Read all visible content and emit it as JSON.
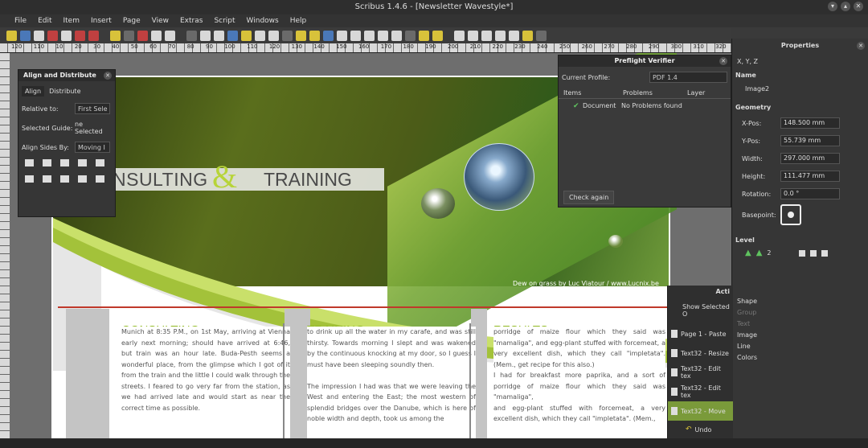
{
  "window": {
    "title": "Scribus 1.4.6 - [Newsletter Wavestyle*]",
    "controls": [
      "▾",
      "▴",
      "✕"
    ]
  },
  "menu": [
    "File",
    "Edit",
    "Item",
    "Insert",
    "Page",
    "View",
    "Extras",
    "Script",
    "Windows",
    "Help"
  ],
  "ruler_labels": [
    "120",
    "110",
    "10",
    "20",
    "30",
    "40",
    "50",
    "60",
    "70",
    "80",
    "90",
    "100",
    "110",
    "120",
    "130",
    "140",
    "150",
    "160",
    "170",
    "180",
    "190",
    "200",
    "210",
    "220",
    "230",
    "240",
    "250",
    "260",
    "270",
    "280",
    "290",
    "300",
    "310",
    "320"
  ],
  "document": {
    "header_consulting": "NSULTING",
    "header_amp": "&",
    "header_training": "TRAINING",
    "photo_caption": "Dew on grass by Luc Viatour / www.Lucnix.be",
    "columns": [
      {
        "heading": "CONSULTING",
        "text": "Munich at 8:35 P.M., on 1st May, arriving at Vienna early next morning; should have arrived at 6:46, but train was an hour late. Buda-Pesth seems a wonderful place, from the glimpse which I got of it from the train and the little I could walk through the streets. I feared to go very far from the station, as we had arrived late and would start as near the correct time as possible."
      },
      {
        "heading": "TRAINING",
        "text": "to drink up all the water in my carafe, and was still thirsty. Towards morning I slept and was wakened by the continuous knocking at my door, so I guess I must have been sleeping soundly then.\n\nThe impression I had was that we were leaving the West and entering the East; the most western of splendid bridges over the Danube, which is here of noble width and depth, took us among the"
      },
      {
        "heading": "RESULTS",
        "text": "porridge of maize flour which they said was \"mamaliga\", and egg-plant stuffed with forcemeat, a very excellent dish, which they call \"impletata\". (Mem., get recipe for this also.)\nI had for breakfast more paprika, and a sort of porridge of maize flour which they said was \"mamaliga\",\nand egg-plant stuffed with forcemeat, a very excellent dish, which they call \"impletata\". (Mem.,"
      }
    ]
  },
  "align_panel": {
    "title": "Align and Distribute",
    "tabs": [
      "Align",
      "Distribute"
    ],
    "relative_label": "Relative to:",
    "relative_value": "First Sele",
    "guide_label": "Selected Guide:",
    "guide_value": "ne Selected",
    "sides_label": "Align Sides By:",
    "sides_value": "Moving I"
  },
  "preflight": {
    "title": "Preflight Verifier",
    "profile_label": "Current Profile:",
    "profile_value": "PDF 1.4",
    "columns": [
      "Items",
      "Problems",
      "Layer"
    ],
    "row_item": "Document",
    "row_problem": "No Problems found",
    "check_button": "Check again"
  },
  "properties": {
    "title": "Properties",
    "tab_xyz": "X, Y, Z",
    "name_label": "Name",
    "name_value": "Image2",
    "geometry_label": "Geometry",
    "fields": [
      {
        "label": "X-Pos:",
        "value": "148.500 mm"
      },
      {
        "label": "Y-Pos:",
        "value": "55.739 mm"
      },
      {
        "label": "Width:",
        "value": "297.000 mm"
      },
      {
        "label": "Height:",
        "value": "111.477 mm"
      },
      {
        "label": "Rotation:",
        "value": "0.0 °"
      }
    ],
    "basepoint_label": "Basepoint:",
    "level_label": "Level",
    "level_value": "2",
    "sections": [
      "Shape",
      "Group",
      "Text",
      "Image",
      "Line",
      "Colors"
    ]
  },
  "actions": {
    "title": "Acti",
    "show_selected": "Show Selected O",
    "items": [
      "Page 1 - Paste",
      "Text32 - Resize",
      "Text32 - Edit tex",
      "Text32 - Edit tex",
      "Text32 - Move"
    ],
    "undo": "Undo"
  },
  "colors": {
    "accent_green": "#8fb81e",
    "selection_red": "#c0392b",
    "panel": "#363636"
  }
}
